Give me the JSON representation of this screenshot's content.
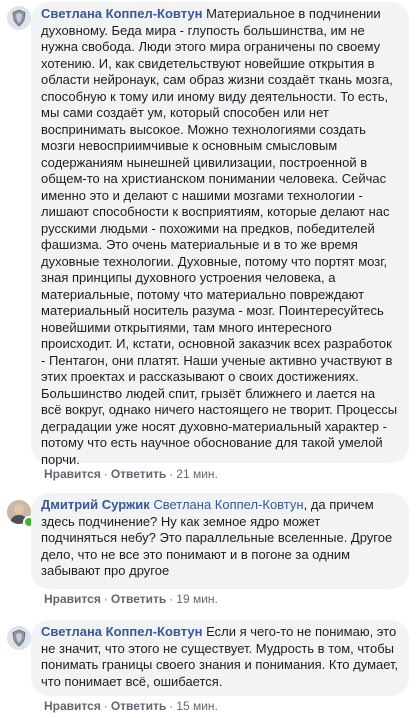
{
  "comments": [
    {
      "author": "Светлана Коппел-Ковтун",
      "mention": "",
      "text": " Материальное в подчинении духовному. Беда мира - глупость большинства, им не нужна свобода. Люди этого мира ограничены по своему хотению. И, как свидетельствуют новейшие открытия в области нейронаук, сам образ жизни создаёт ткань мозга, способную к тому или иному виду деятельности. То есть, мы сами создаёт ум, который способен или нет воспринимать высокое. Можно технологиями создать мозги невосприимчивые к основным смысловым содержаниям нынешней цивилизации, построенной в общем-то на христианском понимании человека. Сейчас именно это и делают с нашими мозгами технологии - лишают способности к восприятиям, которые делают нас русскими людьми - похожими на предков, победителей фашизма. Это очень материальные и в то же время духовные технологии. Духовные, потому что портят мозг, зная принципы духовного устроения человека, а материальные, потому что материально повреждают материальный носитель разума - мозг. Поинтересуйтесь новейшими открытиями, там много интересного происходит. И, кстати, основной заказчик всех разработок - Пентагон, они платят. Наши ученые активно участвуют в этих проектах и рассказывают о своих достижениях. Большинство людей спит, грызёт ближнего и лается на всё вокруг, однако ничего настоящего не творит. Процессы деградации уже носят духовно-материальный характер - потому что есть научное обоснование для такой умелой порчи.",
      "like": "Нравится",
      "reply": "Ответить",
      "time": "21 мин."
    },
    {
      "author": "Дмитрий Суржик",
      "mention": " Светлана Коппел-Ковтун",
      "text": ", да причем здесь подчинение? Ну как земное ядро может подчиняться небу? Это параллельные вселенные. Другое дело, что не все это понимают и в погоне за одним забывают про другое",
      "like": "Нравится",
      "reply": "Ответить",
      "time": "19 мин."
    },
    {
      "author": "Светлана Коппел-Ковтун",
      "mention": "",
      "text": " Если я чего-то не понимаю, это не значит, что этого не существует. Мудрость в том, чтобы понимать границы своего знания и понимания. Кто думает, что понимает всё, ошибается.",
      "like": "Нравится",
      "reply": "Ответить",
      "time": "15 мин."
    }
  ],
  "colors": {
    "author": "#385898",
    "bubble": "#f2f3f5",
    "text": "#1c1e21",
    "meta": "#606770",
    "online": "#42b72a"
  },
  "icons": [
    "avatar-shield-icon",
    "avatar-photo-icon",
    "online-indicator-icon"
  ]
}
